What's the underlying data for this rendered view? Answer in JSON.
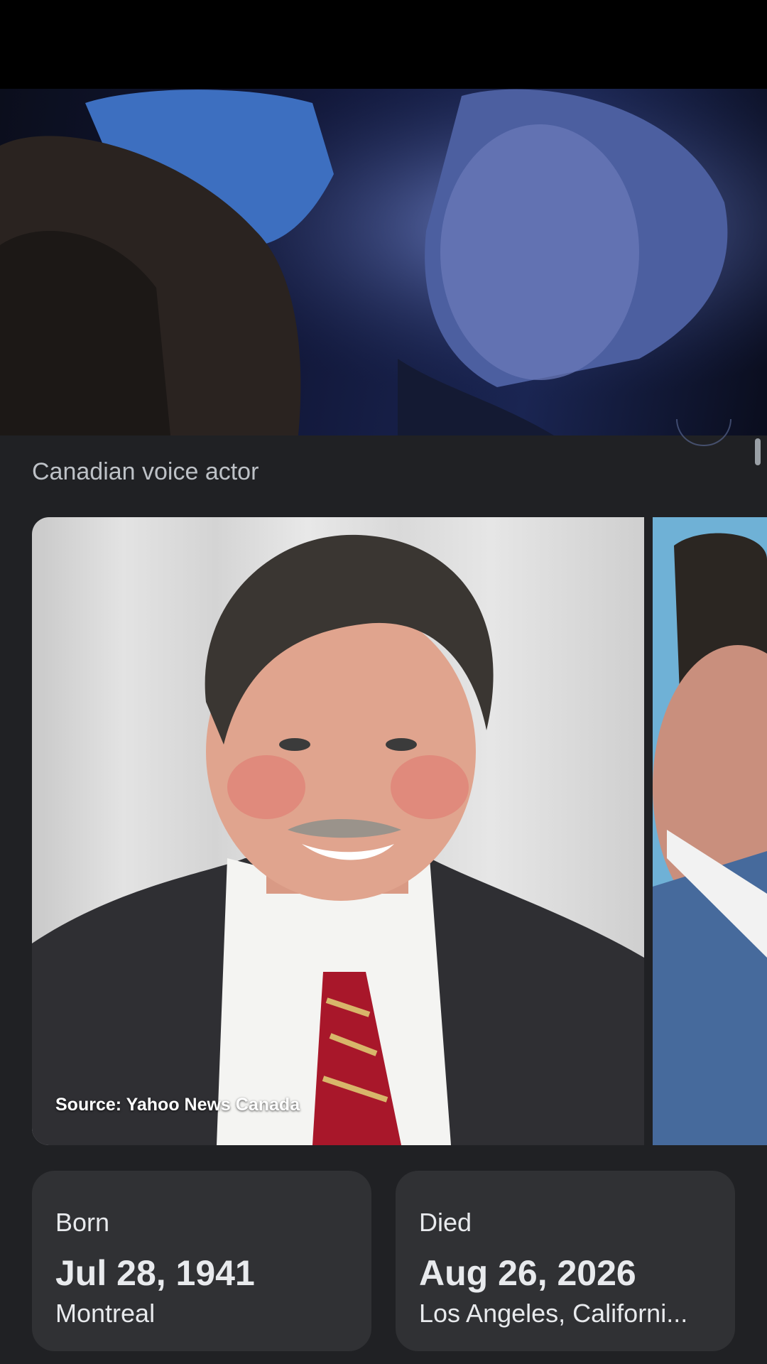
{
  "hero": {
    "image": "movie-scene-image"
  },
  "subtitle": "Canadian voice actor",
  "gallery": {
    "main_image": "portrait-photo",
    "source_label": "Source: Yahoo News Canada",
    "next_image": "portrait-photo-2"
  },
  "born": {
    "label": "Born",
    "date": "Jul 28, 1941",
    "place": "Montreal"
  },
  "died": {
    "label": "Died",
    "date": "Aug 26, 2026",
    "place": "Los Angeles, Californi..."
  },
  "colors": {
    "background": "#202124",
    "card": "#303134",
    "text": "#e8eaed",
    "subtext": "#bdc1c6"
  }
}
